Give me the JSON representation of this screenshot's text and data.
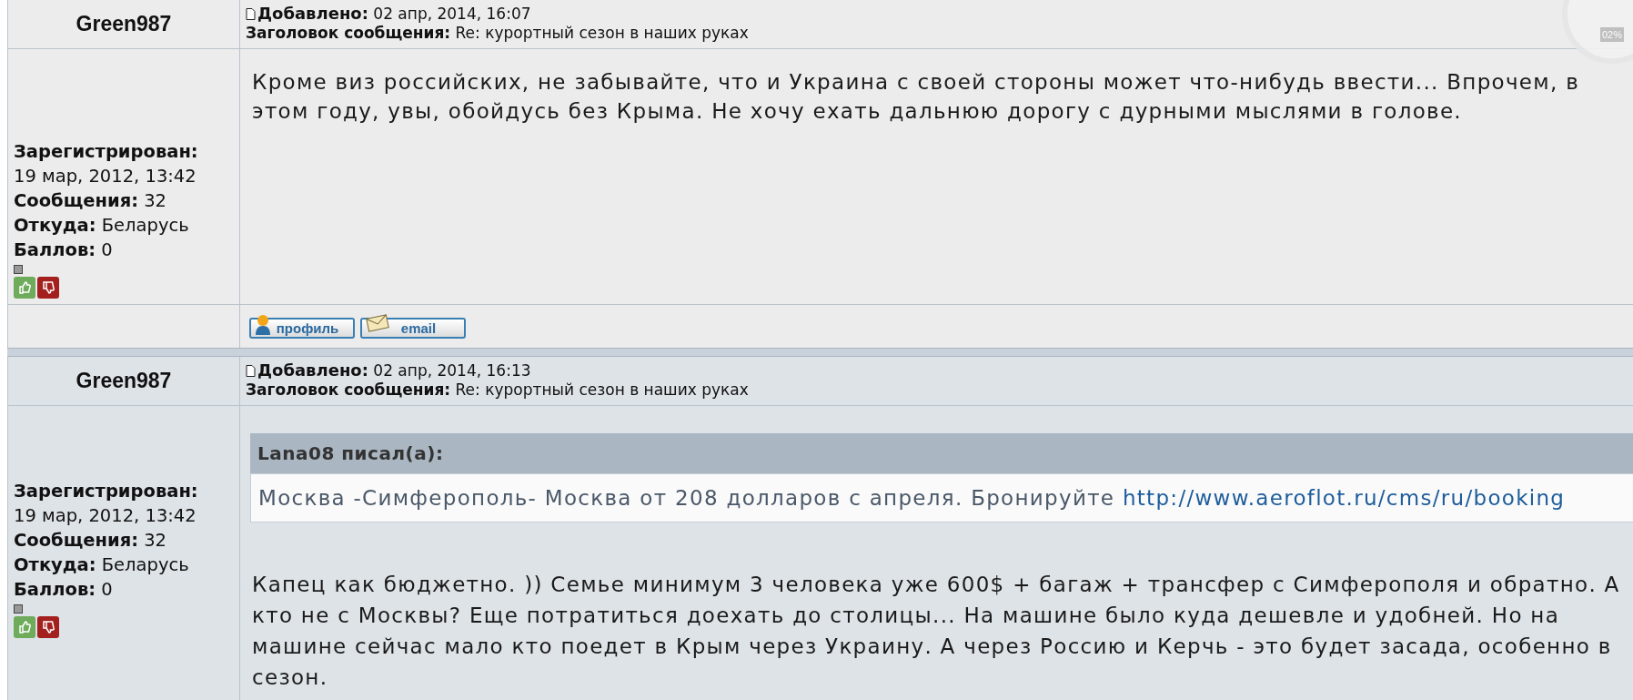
{
  "gauge": {
    "reading": "02%"
  },
  "posts": [
    {
      "author": "Green987",
      "added_label": "Добавлено:",
      "added": "02 апр, 2014, 16:07",
      "subject_label": "Заголовок сообщения:",
      "subject": "Re: курортный сезон в наших руках",
      "registered_label": "Зарегистрирован:",
      "registered": "19 мар, 2012, 13:42",
      "fields": [
        {
          "label": "Сообщения:",
          "value": "32"
        },
        {
          "label": "Откуда:",
          "value": "Беларусь"
        },
        {
          "label": "Баллов:",
          "value": "0"
        }
      ],
      "message": "Кроме виз российских, не забывайте, что и Украина с своей стороны может что-нибудь ввести... Впрочем, в этом году, увы, обойдусь без Крыма. Не хочу ехать дальнюю дорогу с дурными мыслями в голове.",
      "buttons": [
        {
          "kind": "profile",
          "label": "профиль"
        },
        {
          "kind": "email",
          "label": "email"
        }
      ]
    },
    {
      "author": "Green987",
      "added_label": "Добавлено:",
      "added": "02 апр, 2014, 16:13",
      "subject_label": "Заголовок сообщения:",
      "subject": "Re: курортный сезон в наших руках",
      "registered_label": "Зарегистрирован:",
      "registered": "19 мар, 2012, 13:42",
      "fields": [
        {
          "label": "Сообщения:",
          "value": "32"
        },
        {
          "label": "Откуда:",
          "value": "Беларусь"
        },
        {
          "label": "Баллов:",
          "value": "0"
        }
      ],
      "quote": {
        "author": "Lana08 писал(а):",
        "text": "Москва -Симферополь- Москва от 208 долларов с апреля. Бронируйте",
        "link": "http://www.aeroflot.ru/cms/ru/booking"
      },
      "message": "Капец как бюджетно. )) Семье минимум 3 человека уже 600$ + багаж + трансфер с Симферополя и обратно. А кто не с Москвы? Еще потратиться доехать до столицы... На машине было куда дешевле и удобней. Но на машине сейчас мало кто поедет в Крым через Украину. А через Россию и Керчь - это будет засада, особенно в сезон."
    }
  ]
}
